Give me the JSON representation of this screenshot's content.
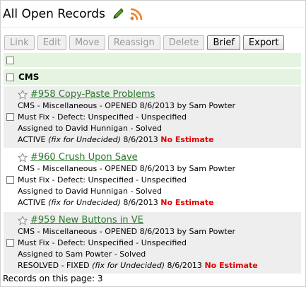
{
  "header": {
    "title": "All Open Records",
    "edit_icon": "pencil-icon",
    "rss_icon": "rss-feed-icon"
  },
  "toolbar": {
    "buttons": [
      {
        "label": "Link",
        "enabled": false
      },
      {
        "label": "Edit",
        "enabled": false
      },
      {
        "label": "Move",
        "enabled": false
      },
      {
        "label": "Reassign",
        "enabled": false
      },
      {
        "label": "Delete",
        "enabled": false
      },
      {
        "label": "Brief",
        "enabled": true
      },
      {
        "label": "Export",
        "enabled": true
      }
    ]
  },
  "group": {
    "label": "CMS"
  },
  "records": [
    {
      "title": "#958 Copy-Paste Problems",
      "line1": "CMS - Miscellaneous - OPENED 8/6/2013 by Sam Powter",
      "line2": "Must Fix - Defect: Unspecified - Unspecified",
      "line3": "Assigned to David Hunnigan - Solved",
      "status": "ACTIVE ",
      "fix": "(fix for Undecided)",
      "date": " 8/6/2013 ",
      "estimate": "No Estimate"
    },
    {
      "title": "#960 Crush Upon Save",
      "line1": "CMS - Miscellaneous - OPENED 8/6/2013 by Sam Powter",
      "line2": "Must Fix - Defect: Unspecified - Unspecified",
      "line3": "Assigned to David Hunnigan - Solved",
      "status": "ACTIVE ",
      "fix": "(fix for Undecided)",
      "date": " 8/6/2013 ",
      "estimate": "No Estimate"
    },
    {
      "title": "#959 New Buttons in VE",
      "line1": "CMS - Miscellaneous - OPENED 8/6/2013 by Sam Powter",
      "line2": "Must Fix - Defect: Unspecified - Unspecified",
      "line3": "Assigned to Sam Powter - Solved",
      "status": "RESOLVED - FIXED ",
      "fix": "(fix for Undecided)",
      "date": " 8/6/2013 ",
      "estimate": "No Estimate"
    }
  ],
  "footer": {
    "text": "Records on this page: 3"
  }
}
